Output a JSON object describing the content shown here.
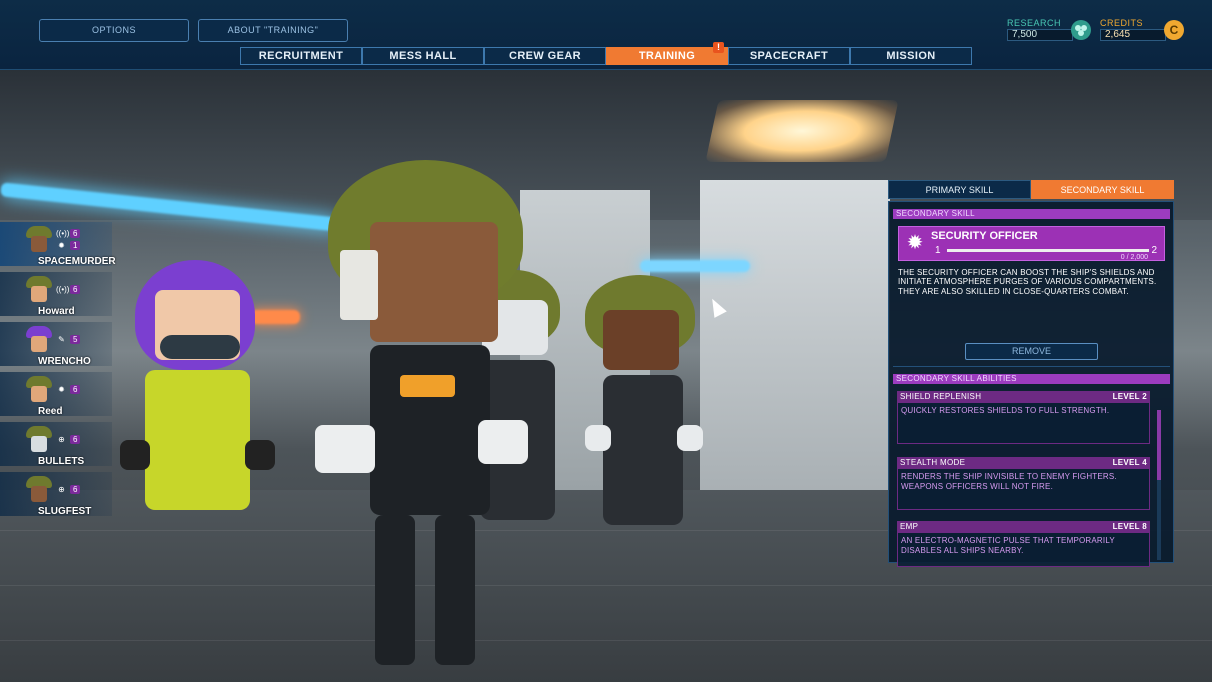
{
  "topbar": {
    "options_label": "OPTIONS",
    "about_label": "ABOUT \"TRAINING\"",
    "tabs": [
      {
        "label": "RECRUITMENT"
      },
      {
        "label": "MESS HALL"
      },
      {
        "label": "CREW GEAR"
      },
      {
        "label": "TRAINING",
        "active": true,
        "alert": "!"
      },
      {
        "label": "SPACECRAFT"
      },
      {
        "label": "MISSION"
      }
    ],
    "research": {
      "label": "RESEARCH",
      "value": "7,500",
      "icon": "research-molecule-icon"
    },
    "credits": {
      "label": "CREDITS",
      "value": "2,645",
      "icon": "credits-coin-icon",
      "symbol": "C"
    }
  },
  "crew": [
    {
      "name": "SPACEMURDER",
      "skills": [
        {
          "icon": "signal-icon",
          "glyph": "((•))",
          "level": "6"
        },
        {
          "icon": "gear-star-icon",
          "glyph": "✹",
          "level": "1"
        }
      ],
      "skin": "#8a5a3a"
    },
    {
      "name": "Howard",
      "skills": [
        {
          "icon": "signal-icon",
          "glyph": "((•))",
          "level": "6"
        }
      ],
      "skin": "#e0a77a"
    },
    {
      "name": "WRENCHO",
      "skills": [
        {
          "icon": "wrench-icon",
          "glyph": "✎",
          "level": "5"
        }
      ],
      "skin": "#7a4fb0"
    },
    {
      "name": "Reed",
      "skills": [
        {
          "icon": "gear-star-icon",
          "glyph": "✹",
          "level": "6"
        }
      ],
      "skin": "#e0a77a"
    },
    {
      "name": "BULLETS",
      "skills": [
        {
          "icon": "crosshair-icon",
          "glyph": "⊕",
          "level": "6"
        }
      ],
      "skin": "#d8dde0"
    },
    {
      "name": "SLUGFEST",
      "skills": [
        {
          "icon": "crosshair-icon",
          "glyph": "⊕",
          "level": "6"
        }
      ],
      "skin": "#8a5a3a"
    }
  ],
  "panel": {
    "tabs": [
      {
        "label": "PRIMARY SKILL"
      },
      {
        "label": "SECONDARY SKILL",
        "active": true
      }
    ],
    "section_title": "SECONDARY SKILL",
    "skill": {
      "name": "SECURITY OFFICER",
      "icon": "gear-star-icon",
      "level_from": "1",
      "level_to": "2",
      "progress_text": "0 / 2,000",
      "progress_fraction": 0.0
    },
    "description": "THE SECURITY OFFICER CAN BOOST THE SHIP'S SHIELDS AND INITIATE ATMOSPHERE PURGES OF VARIOUS COMPARTMENTS. THEY ARE ALSO SKILLED IN CLOSE-QUARTERS COMBAT.",
    "remove_label": "REMOVE",
    "abilities_title": "SECONDARY SKILL ABILITIES",
    "abilities": [
      {
        "name": "SHIELD REPLENISH",
        "level": "LEVEL 2",
        "desc": "QUICKLY RESTORES SHIELDS TO FULL STRENGTH."
      },
      {
        "name": "STEALTH MODE",
        "level": "LEVEL 4",
        "desc": "RENDERS THE SHIP INVISIBLE TO ENEMY FIGHTERS. WEAPONS OFFICERS WILL NOT FIRE."
      },
      {
        "name": "EMP",
        "level": "LEVEL 8",
        "desc": "AN ELECTRO-MAGNETIC PULSE THAT TEMPORARILY DISABLES ALL SHIPS NEARBY."
      }
    ]
  },
  "colors": {
    "accent": "#f07a32",
    "purple": "#9c31b5",
    "navy": "#0a2440"
  }
}
